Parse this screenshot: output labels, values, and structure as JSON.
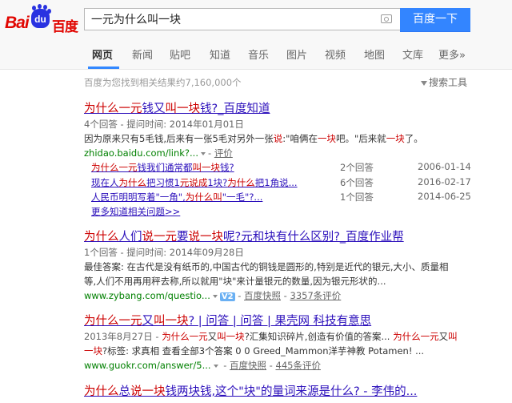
{
  "logo": {
    "latin": "Bai",
    "paw": "du",
    "cn": "百度"
  },
  "search": {
    "query": "一元为什么叫一块",
    "button_label": "百度一下"
  },
  "nav_tabs": [
    "网页",
    "新闻",
    "贴吧",
    "知道",
    "音乐",
    "图片",
    "视频",
    "地图",
    "文库",
    "更多»"
  ],
  "stats": "百度为您找到相关结果约7,160,000个",
  "search_tools": "搜索工具",
  "r1": {
    "title": [
      "为什么一元",
      "钱又",
      "叫一块",
      "钱?_百度知道"
    ],
    "meta": "4个回答 - 提问时间: 2014年01月01日",
    "snippet": [
      "因为原来只有5毛钱,后来有一张5毛对另外一张",
      "说",
      ":\"咱俩在",
      "一块",
      "吧。\"后来就",
      "一块",
      "了。"
    ],
    "url": "zhidao.baidu.com/link?...",
    "evaluate": "评价",
    "subs": [
      {
        "t": [
          "为什么一元",
          "钱我们通常都",
          "叫一块",
          "钱?"
        ],
        "count": "2个回答",
        "date": "2006-01-14"
      },
      {
        "t": [
          "现在人",
          "为什么",
          "把习惯1",
          "元说成",
          "1块?",
          "为什么",
          "把1角说..."
        ],
        "count": "6个回答",
        "date": "2016-02-17"
      },
      {
        "t": [
          "人民币明明写着\"一角\",",
          "为什么叫",
          "\"一毛\"?..."
        ],
        "count": "1个回答",
        "date": "2014-06-25"
      }
    ],
    "more": "更多知道相关问题>>"
  },
  "r2": {
    "title": [
      "为什么",
      "人们",
      "说一元",
      "要",
      "说一块",
      "呢?元和块有什么区别?_百度作业帮"
    ],
    "meta": "1个回答 - 提问时间: 2014年09月28日",
    "line1": "最佳答案: 在古代是没有纸币的,中国古代的铜钱是圆形的,特别是近代的银元,大小、质量相",
    "line2": "等,人们不用再用秤去称,所以就用\"块\"来计量银元的数量,因为银元形状的...",
    "url": "www.zybang.com/questio...",
    "v": "V2",
    "snapshot": "百度快照",
    "reviews": "3357条评价"
  },
  "r3": {
    "title": [
      "为什么一元",
      "又",
      "叫一块",
      "? | 问答 | 问答 | 果壳网 科技有意思"
    ],
    "line1": [
      "2013年8月27日 - ",
      "为什么一元",
      "又",
      "叫一块",
      "?汇集知识碎片,创造有价值的答案... ",
      "为什么一元",
      "又",
      "叫"
    ],
    "line2": [
      "一块",
      "?标签: 求真相 查看全部3个答案 0 0 Greed_Mammon洋芋神教 Potamen! ..."
    ],
    "url": "www.guokr.com/answer/5...",
    "snapshot": "百度快照",
    "reviews": "445条评价"
  },
  "r4": {
    "title": [
      "为什么",
      "总",
      "说一块",
      "钱两块钱,这个\"块\"的量词来源是什么? - 李伟的..."
    ]
  }
}
